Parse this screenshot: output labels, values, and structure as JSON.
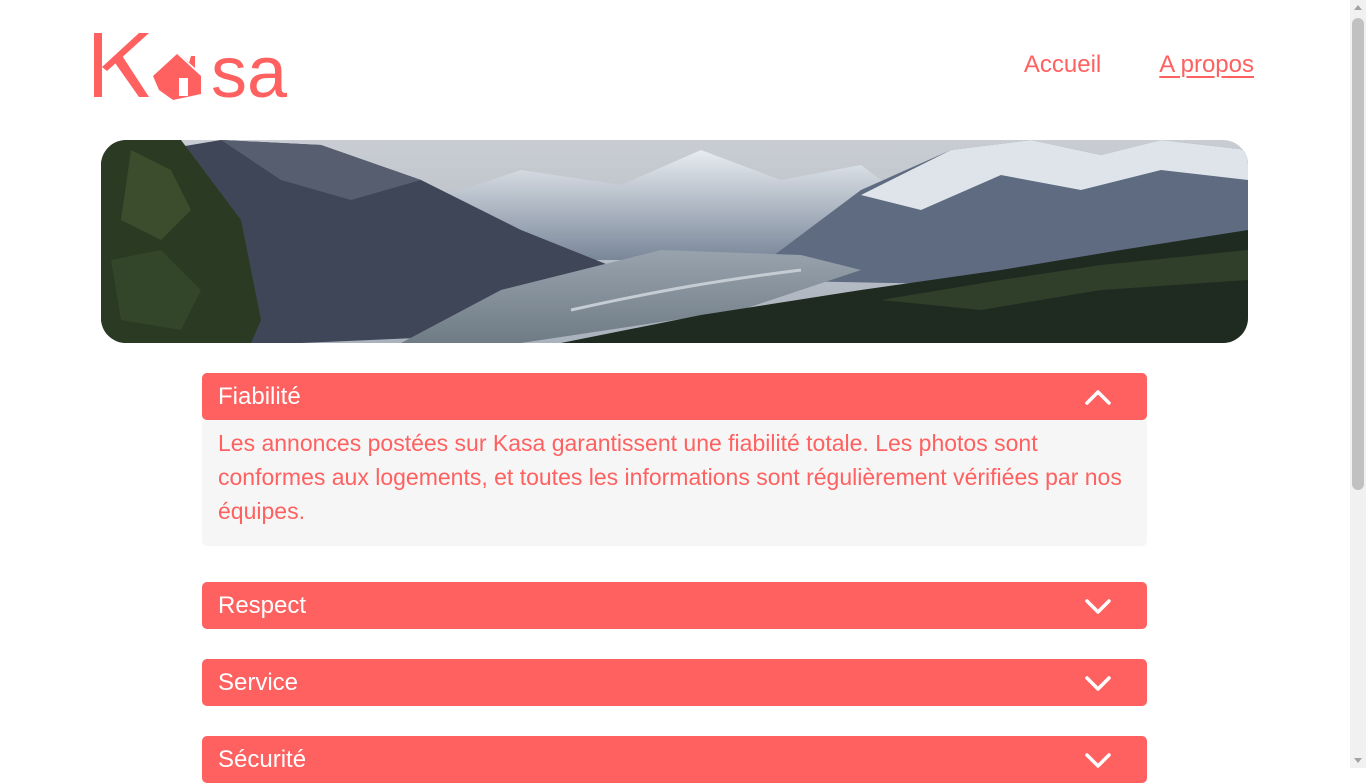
{
  "brand": {
    "logo_text": "Kasa",
    "color": "#FF6060"
  },
  "nav": {
    "items": [
      {
        "label": "Accueil"
      },
      {
        "label": "A propos",
        "active": true
      }
    ]
  },
  "banner": {
    "image": "mountain-valley-landscape"
  },
  "collapses": [
    {
      "title": "Fiabilité",
      "expanded": true,
      "icon": "chevron-up-icon",
      "content": "Les annonces postées sur Kasa garantissent une fiabilité totale. Les photos sont conformes aux logements, et toutes les informations sont régulièrement vérifiées par nos équipes."
    },
    {
      "title": "Respect",
      "expanded": false,
      "icon": "chevron-down-icon"
    },
    {
      "title": "Service",
      "expanded": false,
      "icon": "chevron-down-icon"
    },
    {
      "title": "Sécurité",
      "expanded": false,
      "icon": "chevron-down-icon"
    }
  ],
  "colors": {
    "accent": "#FF6060",
    "panel_bg": "#F6F6F6",
    "text_on_accent": "#FFFFFF"
  }
}
